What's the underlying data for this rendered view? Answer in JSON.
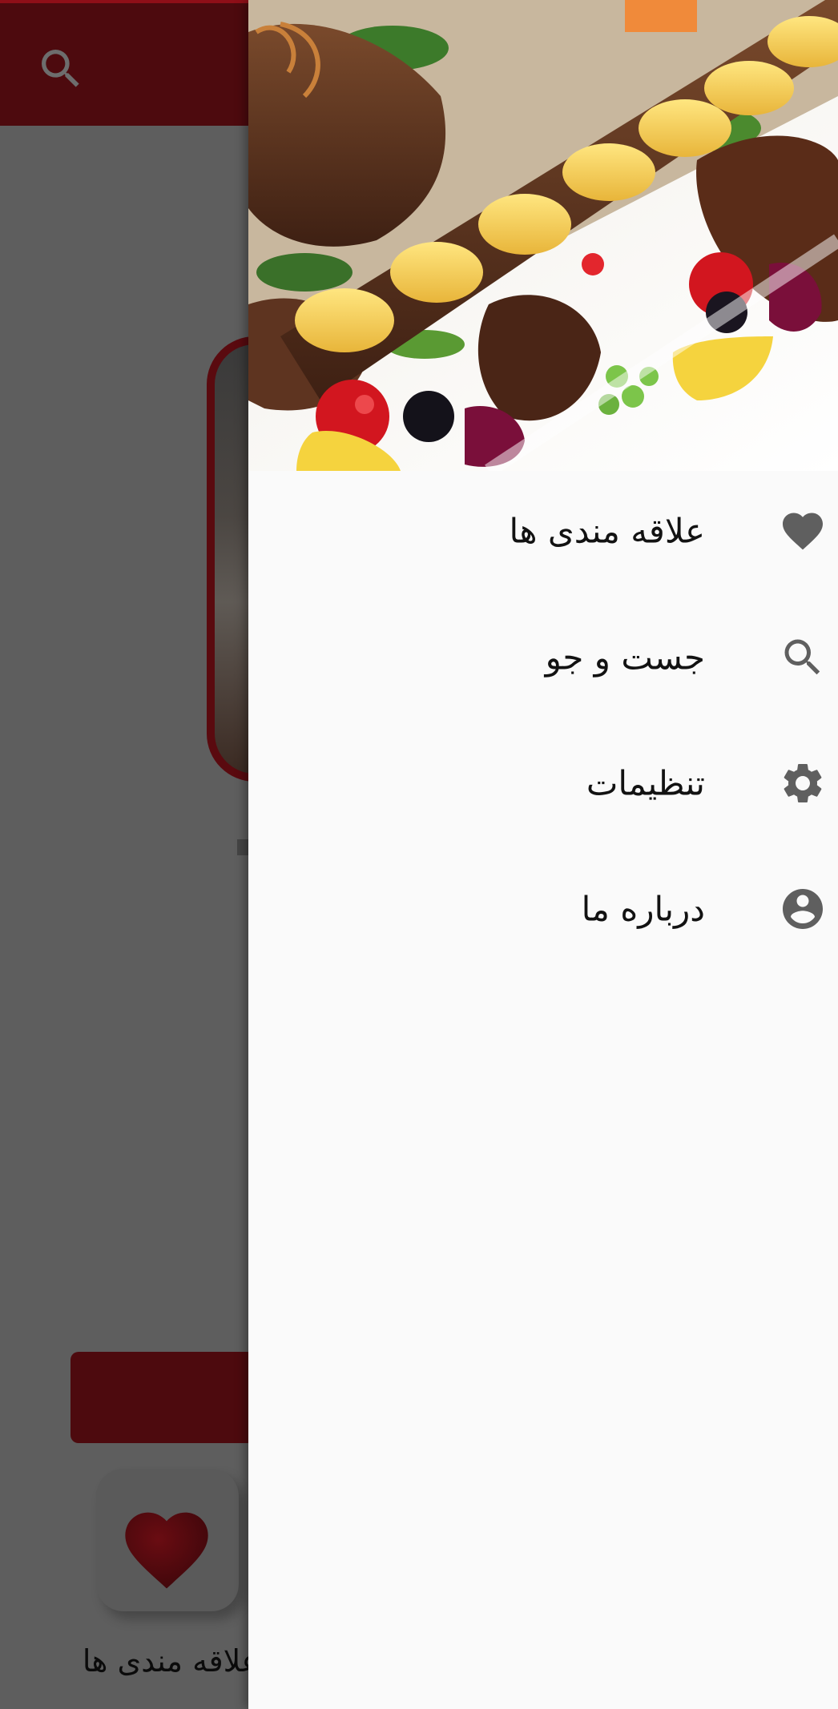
{
  "drawer": {
    "items": [
      {
        "label": "علاقه مندی ها",
        "icon": "heart-icon"
      },
      {
        "label": "جست و جو",
        "icon": "search-icon"
      },
      {
        "label": "تنظیمات",
        "icon": "gear-icon"
      },
      {
        "label": "درباره ما",
        "icon": "account-circle-icon"
      }
    ]
  },
  "background": {
    "favorites_label": "علاقه مندی ها"
  },
  "colors": {
    "primary": "#8f0f18",
    "primary_dark": "#4d0a0e",
    "drawer_bg": "#fafafa",
    "scrim_bg": "#5e5e5e",
    "icon_grey": "#616161"
  }
}
